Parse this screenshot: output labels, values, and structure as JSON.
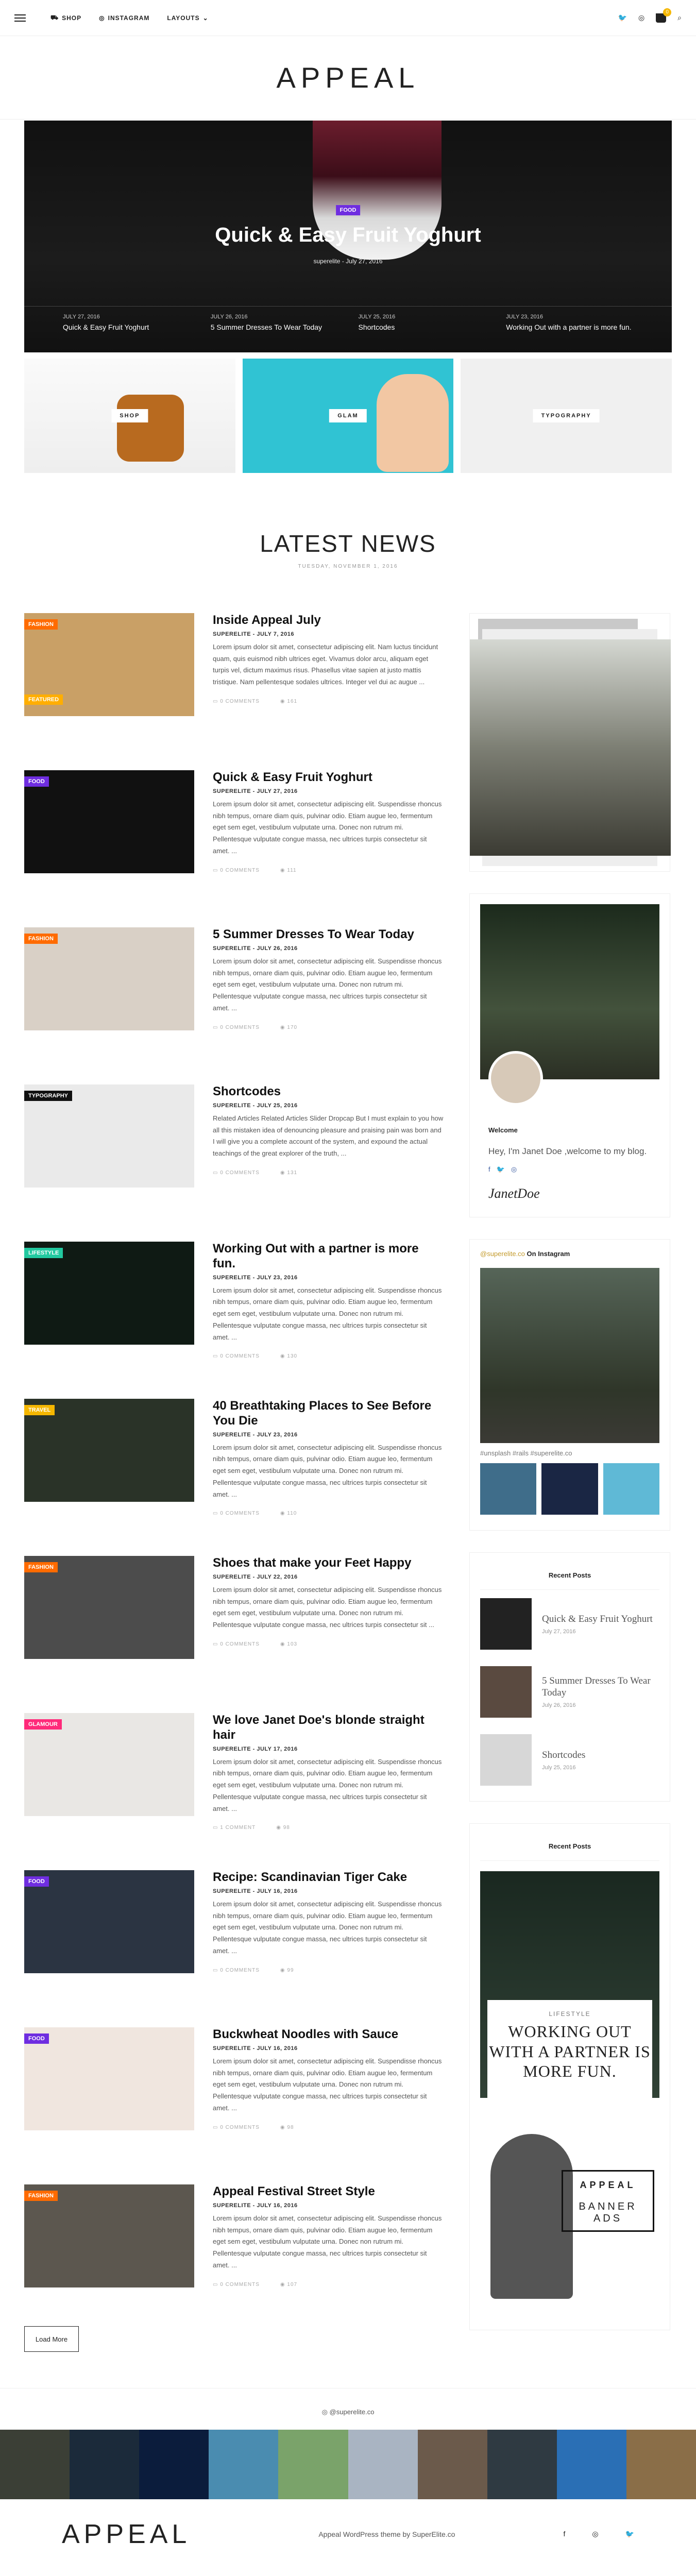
{
  "header": {
    "nav": [
      "SHOP",
      "INSTAGRAM",
      "LAYOUTS"
    ],
    "cart_count": "0",
    "logo": "APPEAL"
  },
  "hero": {
    "category": "FOOD",
    "title": "Quick & Easy Fruit Yoghurt",
    "meta": "superelite - July 27, 2016",
    "slides": [
      {
        "date": "JULY 27, 2016",
        "title": "Quick & Easy Fruit Yoghurt"
      },
      {
        "date": "JULY 26, 2016",
        "title": "5 Summer Dresses To Wear Today"
      },
      {
        "date": "JULY 25, 2016",
        "title": "Shortcodes"
      },
      {
        "date": "JULY 23, 2016",
        "title": "Working Out with a partner is more fun."
      }
    ]
  },
  "promos": [
    "SHOP",
    "GLAM",
    "TYPOGRAPHY"
  ],
  "latest": {
    "title": "LATEST NEWS",
    "date": "TUESDAY, NOVEMBER 1, 2016"
  },
  "posts": [
    {
      "cat": "FASHION",
      "cat2": "FEATURED",
      "color": "#ff6b00",
      "title": "Inside Appeal July",
      "meta": "SUPERELITE - JULY 7, 2016",
      "excerpt": "Lorem ipsum dolor sit amet, consectetur adipiscing elit. Nam luctus tincidunt quam, quis euismod nibh ultrices eget. Vivamus dolor arcu, aliquam eget turpis vel, dictum maximus risus. Phasellus vitae sapien at justo mattis tristique. Nam pellentesque sodales ultrices. Integer vel dui ac augue ...",
      "comments": "0 COMMENTS",
      "views": "161"
    },
    {
      "cat": "FOOD",
      "color": "#6f2de0",
      "title": "Quick & Easy Fruit Yoghurt",
      "meta": "SUPERELITE - JULY 27, 2016",
      "excerpt": "Lorem ipsum dolor sit amet, consectetur adipiscing elit. Suspendisse rhoncus nibh tempus, ornare diam quis, pulvinar odio. Etiam augue leo, fermentum eget sem eget, vestibulum vulputate urna. Donec non rutrum mi. Pellentesque vulputate congue massa, nec ultrices turpis consectetur sit amet. ...",
      "comments": "0 COMMENTS",
      "views": "111"
    },
    {
      "cat": "FASHION",
      "color": "#ff6b00",
      "title": "5 Summer Dresses To Wear Today",
      "meta": "SUPERELITE - JULY 26, 2016",
      "excerpt": "Lorem ipsum dolor sit amet, consectetur adipiscing elit. Suspendisse rhoncus nibh tempus, ornare diam quis, pulvinar odio. Etiam augue leo, fermentum eget sem eget, vestibulum vulputate urna. Donec non rutrum mi. Pellentesque vulputate congue massa, nec ultrices turpis consectetur sit amet. ...",
      "comments": "0 COMMENTS",
      "views": "170"
    },
    {
      "cat": "TYPOGRAPHY",
      "color": "#111111",
      "title": "Shortcodes",
      "meta": "SUPERELITE - JULY 25, 2016",
      "excerpt": "Related Articles Related Articles Slider Dropcap But I must explain to you how all this mistaken idea of denouncing pleasure and praising pain was born and I will give you a complete account of the system, and expound the actual teachings of the great explorer of the truth, ...",
      "comments": "0 COMMENTS",
      "views": "131"
    },
    {
      "cat": "LIFESTYLE",
      "color": "#22c9a0",
      "title": "Working Out with a partner is more fun.",
      "meta": "SUPERELITE - JULY 23, 2016",
      "excerpt": "Lorem ipsum dolor sit amet, consectetur adipiscing elit. Suspendisse rhoncus nibh tempus, ornare diam quis, pulvinar odio. Etiam augue leo, fermentum eget sem eget, vestibulum vulputate urna. Donec non rutrum mi. Pellentesque vulputate congue massa, nec ultrices turpis consectetur sit amet. ...",
      "comments": "0 COMMENTS",
      "views": "130"
    },
    {
      "cat": "TRAVEL",
      "color": "#f5b700",
      "title": "40 Breathtaking Places to See Before You Die",
      "meta": "SUPERELITE - JULY 23, 2016",
      "excerpt": "Lorem ipsum dolor sit amet, consectetur adipiscing elit. Suspendisse rhoncus nibh tempus, ornare diam quis, pulvinar odio. Etiam augue leo, fermentum eget sem eget, vestibulum vulputate urna. Donec non rutrum mi. Pellentesque vulputate congue massa, nec ultrices turpis consectetur sit amet. ...",
      "comments": "0 COMMENTS",
      "views": "110"
    },
    {
      "cat": "FASHION",
      "color": "#ff6b00",
      "title": "Shoes that make your Feet Happy",
      "meta": "SUPERELITE - JULY 22, 2016",
      "excerpt": "Lorem ipsum dolor sit amet, consectetur adipiscing elit. Suspendisse rhoncus nibh tempus, ornare diam quis, pulvinar odio. Etiam augue leo, fermentum eget sem eget, vestibulum vulputate urna. Donec non rutrum mi. Pellentesque vulputate congue massa, nec ultrices turpis consectetur sit ...",
      "comments": "0 COMMENTS",
      "views": "103"
    },
    {
      "cat": "GLAMOUR",
      "color": "#ff2a7a",
      "title": "We love Janet Doe's blonde straight hair",
      "meta": "SUPERELITE - JULY 17, 2016",
      "excerpt": "Lorem ipsum dolor sit amet, consectetur adipiscing elit. Suspendisse rhoncus nibh tempus, ornare diam quis, pulvinar odio. Etiam augue leo, fermentum eget sem eget, vestibulum vulputate urna. Donec non rutrum mi. Pellentesque vulputate congue massa, nec ultrices turpis consectetur sit amet. ...",
      "comments": "1 COMMENT",
      "views": "98"
    },
    {
      "cat": "FOOD",
      "color": "#6f2de0",
      "title": "Recipe: Scandinavian Tiger Cake",
      "meta": "SUPERELITE - JULY 16, 2016",
      "excerpt": "Lorem ipsum dolor sit amet, consectetur adipiscing elit. Suspendisse rhoncus nibh tempus, ornare diam quis, pulvinar odio. Etiam augue leo, fermentum eget sem eget, vestibulum vulputate urna. Donec non rutrum mi. Pellentesque vulputate congue massa, nec ultrices turpis consectetur sit amet. ...",
      "comments": "0 COMMENTS",
      "views": "99"
    },
    {
      "cat": "FOOD",
      "color": "#6f2de0",
      "title": "Buckwheat Noodles with Sauce",
      "meta": "SUPERELITE - JULY 16, 2016",
      "excerpt": "Lorem ipsum dolor sit amet, consectetur adipiscing elit. Suspendisse rhoncus nibh tempus, ornare diam quis, pulvinar odio. Etiam augue leo, fermentum eget sem eget, vestibulum vulputate urna. Donec non rutrum mi. Pellentesque vulputate congue massa, nec ultrices turpis consectetur sit amet. ...",
      "comments": "0 COMMENTS",
      "views": "98"
    },
    {
      "cat": "FASHION",
      "color": "#ff6b00",
      "title": "Appeal Festival Street Style",
      "meta": "SUPERELITE - JULY 16, 2016",
      "excerpt": "Lorem ipsum dolor sit amet, consectetur adipiscing elit. Suspendisse rhoncus nibh tempus, ornare diam quis, pulvinar odio. Etiam augue leo, fermentum eget sem eget, vestibulum vulputate urna. Donec non rutrum mi. Pellentesque vulputate congue massa, nec ultrices turpis consectetur sit amet. ...",
      "comments": "0 COMMENTS",
      "views": "107"
    }
  ],
  "load_more": "Load More",
  "sidebar": {
    "about": {
      "title": "Welcome",
      "text": "Hey, I'm Janet Doe ,welcome to my blog.",
      "signature": "JanetDoe"
    },
    "instagram": {
      "handle": "@superelite.co",
      "suffix": "On Instagram",
      "tags": "#unsplash #rails #superelite.co"
    },
    "recent_title": "Recent Posts",
    "recent": [
      {
        "title": "Quick & Easy Fruit Yoghurt",
        "date": "July 27, 2016"
      },
      {
        "title": "5 Summer Dresses To Wear Today",
        "date": "July 26, 2016"
      },
      {
        "title": "Shortcodes",
        "date": "July 25, 2016"
      }
    ],
    "featured_title": "Recent Posts",
    "featured": {
      "category": "LIFESTYLE",
      "title": "WORKING OUT WITH A PARTNER IS MORE FUN."
    },
    "banner": {
      "line1": "APPEAL",
      "line2": "BANNER ADS"
    }
  },
  "footer": {
    "insta_handle": "@superelite.co",
    "logo": "APPEAL",
    "credit": "Appeal WordPress theme by SuperElite.co"
  }
}
